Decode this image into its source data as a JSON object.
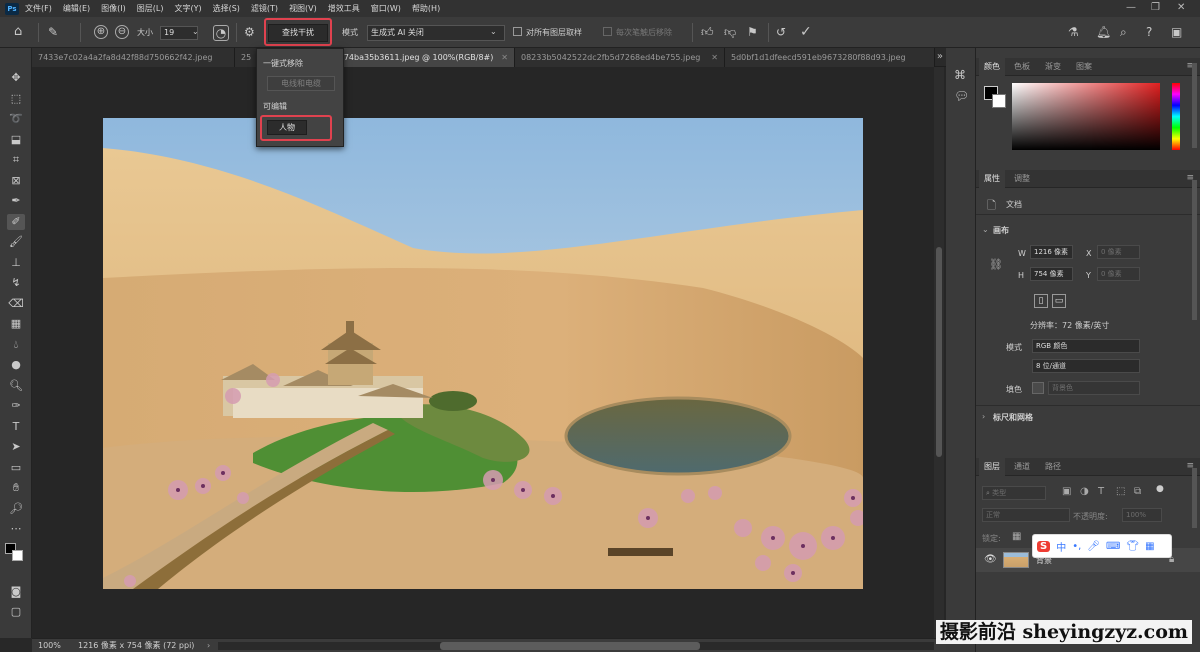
{
  "app": {
    "logo": "Ps"
  },
  "menu": [
    "文件(F)",
    "编辑(E)",
    "图像(I)",
    "图层(L)",
    "文字(Y)",
    "选择(S)",
    "滤镜(T)",
    "视图(V)",
    "增效工具",
    "窗口(W)",
    "帮助(H)"
  ],
  "options": {
    "size_label": "大小",
    "size_value": "19",
    "find_distractions": "查找干扰",
    "mode_label": "模式",
    "mode_value": "生成式 AI 关闭",
    "sample_all": "对所有图层取样",
    "remove_after_stroke": "每次笔触后移除"
  },
  "dropdown": {
    "one_click_remove": "一键式移除",
    "wires_and_cables": "电线和电缆",
    "editable_label": "可编辑",
    "people": "人物"
  },
  "tabs": [
    {
      "label": "7433e7c02a4a2fa8d42f88d750662f42.jpeg",
      "active": false
    },
    {
      "label": "25",
      "active": false
    },
    {
      "label": "f74ba35b3611.jpeg @ 100%(RGB/8#)",
      "active": true
    },
    {
      "label": "08233b5042522dc2fb5d7268ed4be755.jpeg",
      "active": false
    },
    {
      "label": "5d0bf1d1dfeecd591eb9673280f88d93.jpeg",
      "active": false
    }
  ],
  "status": {
    "zoom": "100%",
    "doc_info": "1216 像素 x 754 像素 (72 ppi)"
  },
  "color_panel": {
    "tabs": [
      "颜色",
      "色板",
      "渐变",
      "图案"
    ],
    "active_tab": "颜色",
    "foreground": "#000000",
    "background": "#ffffff",
    "hue": "#e02020"
  },
  "properties_panel": {
    "tabs": [
      "属性",
      "调整"
    ],
    "doc_label": "文档",
    "canvas_section": "画布",
    "w_label": "W",
    "w_value": "1216 像素",
    "h_label": "H",
    "h_value": "754 像素",
    "x_label": "X",
    "x_placeholder": "0 像素",
    "y_label": "Y",
    "y_placeholder": "0 像素",
    "resolution": "分辨率：72 像素/英寸",
    "mode_label": "模式",
    "mode_value": "RGB 颜色",
    "bit_value": "8 位/通道",
    "fill_label": "填色",
    "fill_value": "背景色",
    "rulers_section": "标尺和网格"
  },
  "layers_panel": {
    "tabs": [
      "图层",
      "通道",
      "路径"
    ],
    "filter_placeholder": "类型",
    "blend_mode": "正常",
    "opacity_label": "不透明度:",
    "opacity_value": "100%",
    "lock_label": "锁定:",
    "layer_name": "背景"
  },
  "ime": {
    "label": "中"
  },
  "watermark": "摄影前沿 sheyingzyz.com"
}
